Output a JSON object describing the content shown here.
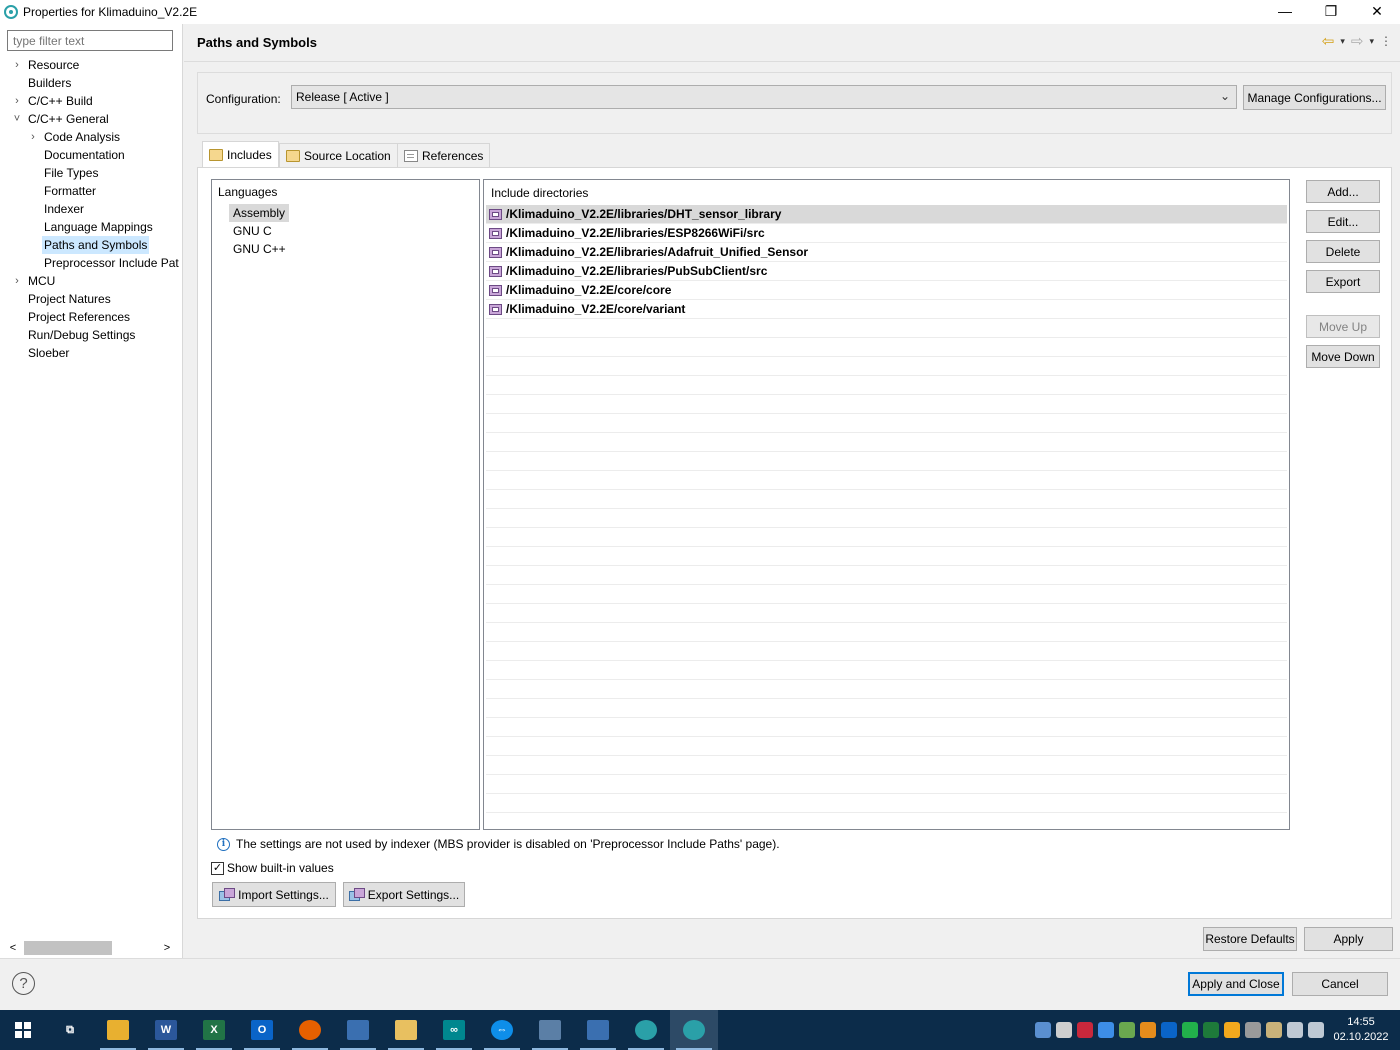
{
  "window": {
    "title": "Properties for Klimaduino_V2.2E",
    "minimize": "—",
    "restore": "❐",
    "close": "✕"
  },
  "filter": {
    "placeholder": "type filter text"
  },
  "tree": [
    {
      "label": "Resource",
      "level": 0,
      "expander": "›",
      "selected": false
    },
    {
      "label": "Builders",
      "level": 0,
      "expander": "",
      "selected": false
    },
    {
      "label": "C/C++ Build",
      "level": 0,
      "expander": "›",
      "selected": false
    },
    {
      "label": "C/C++ General",
      "level": 0,
      "expander": "˅",
      "selected": false
    },
    {
      "label": "Code Analysis",
      "level": 1,
      "expander": "›",
      "selected": false
    },
    {
      "label": "Documentation",
      "level": 1,
      "expander": "",
      "selected": false
    },
    {
      "label": "File Types",
      "level": 1,
      "expander": "",
      "selected": false
    },
    {
      "label": "Formatter",
      "level": 1,
      "expander": "",
      "selected": false
    },
    {
      "label": "Indexer",
      "level": 1,
      "expander": "",
      "selected": false
    },
    {
      "label": "Language Mappings",
      "level": 1,
      "expander": "",
      "selected": false
    },
    {
      "label": "Paths and Symbols",
      "level": 1,
      "expander": "",
      "selected": true
    },
    {
      "label": "Preprocessor Include Pat",
      "level": 1,
      "expander": "",
      "selected": false
    },
    {
      "label": "MCU",
      "level": 0,
      "expander": "›",
      "selected": false
    },
    {
      "label": "Project Natures",
      "level": 0,
      "expander": "",
      "selected": false
    },
    {
      "label": "Project References",
      "level": 0,
      "expander": "",
      "selected": false
    },
    {
      "label": "Run/Debug Settings",
      "level": 0,
      "expander": "",
      "selected": false
    },
    {
      "label": "Sloeber",
      "level": 0,
      "expander": "",
      "selected": false
    }
  ],
  "page": {
    "heading": "Paths and Symbols",
    "nav": {
      "back": "⇦",
      "forward": "⇨",
      "dropdown": "▾",
      "menu": "⋮"
    }
  },
  "config": {
    "label": "Configuration:",
    "value": "Release  [ Active ]",
    "manage_label": "Manage Configurations..."
  },
  "tabs": [
    "Includes",
    "Source Location",
    "References"
  ],
  "languages": {
    "header": "Languages",
    "items": [
      "Assembly",
      "GNU C",
      "GNU C++"
    ],
    "selected_index": 0
  },
  "includes": {
    "header": "Include directories",
    "items": [
      "/Klimaduino_V2.2E/libraries/DHT_sensor_library",
      "/Klimaduino_V2.2E/libraries/ESP8266WiFi/src",
      "/Klimaduino_V2.2E/libraries/Adafruit_Unified_Sensor",
      "/Klimaduino_V2.2E/libraries/PubSubClient/src",
      "/Klimaduino_V2.2E/core/core",
      "/Klimaduino_V2.2E/core/variant"
    ],
    "selected_index": 0
  },
  "side_buttons": {
    "add": "Add...",
    "edit": "Edit...",
    "delete": "Delete",
    "export": "Export",
    "move_up": "Move Up",
    "move_down": "Move Down"
  },
  "info_text": "The settings are not used by indexer (MBS provider is disabled on 'Preprocessor Include Paths' page).",
  "show_builtin": {
    "label": "Show built-in values",
    "checked": true
  },
  "import_settings": "Import Settings...",
  "export_settings": "Export Settings...",
  "restore_defaults": "Restore Defaults",
  "apply": "Apply",
  "apply_and_close": "Apply and Close",
  "cancel": "Cancel",
  "taskbar": {
    "time": "14:55",
    "date": "02.10.2022",
    "apps": [
      {
        "name": "task-view",
        "color": "#0c2c4a",
        "glyph": "⧉"
      },
      {
        "name": "file-explorer",
        "color": "#e8b030",
        "glyph": ""
      },
      {
        "name": "word",
        "color": "#2b579a",
        "glyph": "W"
      },
      {
        "name": "excel",
        "color": "#217346",
        "glyph": "X"
      },
      {
        "name": "outlook",
        "color": "#0a64c8",
        "glyph": "O"
      },
      {
        "name": "firefox",
        "color": "#e66000",
        "glyph": ""
      },
      {
        "name": "network-tool",
        "color": "#3a6fb0",
        "glyph": ""
      },
      {
        "name": "folder-app",
        "color": "#e8c060",
        "glyph": ""
      },
      {
        "name": "arduino",
        "color": "#00878f",
        "glyph": "∞"
      },
      {
        "name": "teamviewer",
        "color": "#0e8ee9",
        "glyph": "⇔"
      },
      {
        "name": "tool-app",
        "color": "#5b7fa6",
        "glyph": ""
      },
      {
        "name": "notepad-app",
        "color": "#3a6fb0",
        "glyph": ""
      },
      {
        "name": "sloeber-1",
        "color": "#2aa0a8",
        "glyph": ""
      },
      {
        "name": "sloeber-2",
        "color": "#2aa0a8",
        "glyph": ""
      }
    ]
  }
}
